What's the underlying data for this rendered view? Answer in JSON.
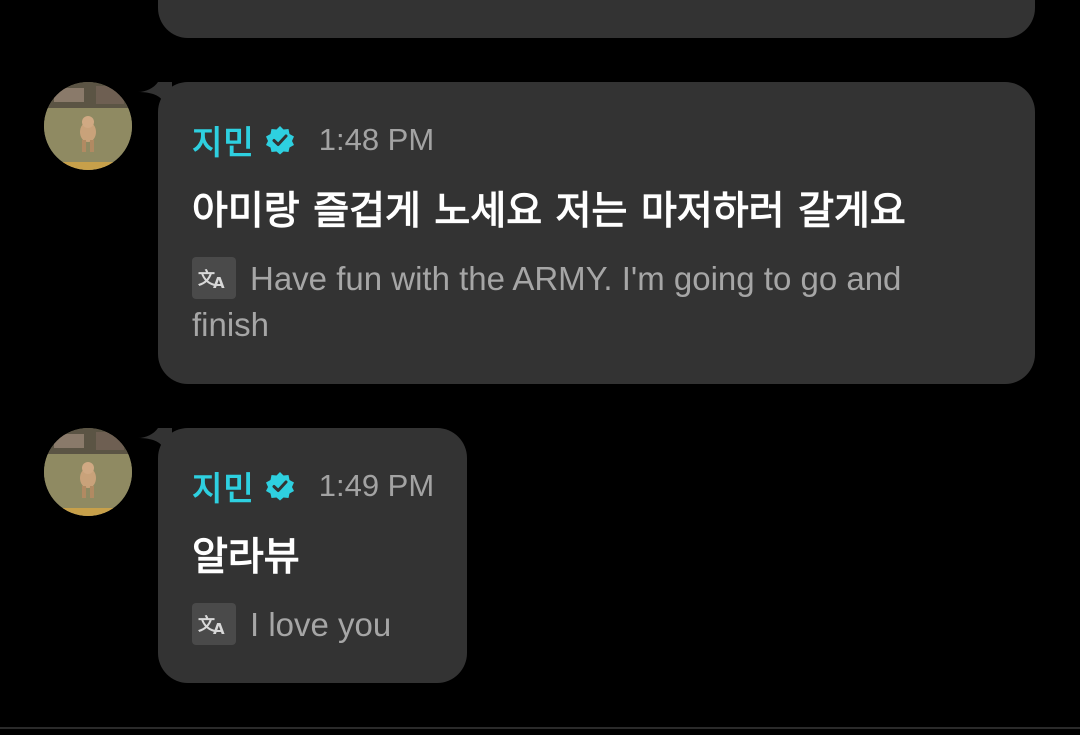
{
  "colors": {
    "background": "#000000",
    "bubble": "#333333",
    "name": "#2ed0e0",
    "time": "#a3a3a3",
    "message": "#ffffff",
    "translation": "#a6a6a6"
  },
  "messages": [
    {
      "sender": "지민",
      "verified_icon": "verified-badge-icon",
      "time": "1:48 PM",
      "text": "아미랑 즐겁게 노세요 저는 마저하러 갈게요",
      "translation_icon": "translate-icon",
      "translation_line1": "Have fun with the ARMY. I'm going to go and",
      "translation_line2": "finish"
    },
    {
      "sender": "지민",
      "verified_icon": "verified-badge-icon",
      "time": "1:49 PM",
      "text": "알라뷰",
      "translation_icon": "translate-icon",
      "translation_line1": "I love you"
    }
  ]
}
